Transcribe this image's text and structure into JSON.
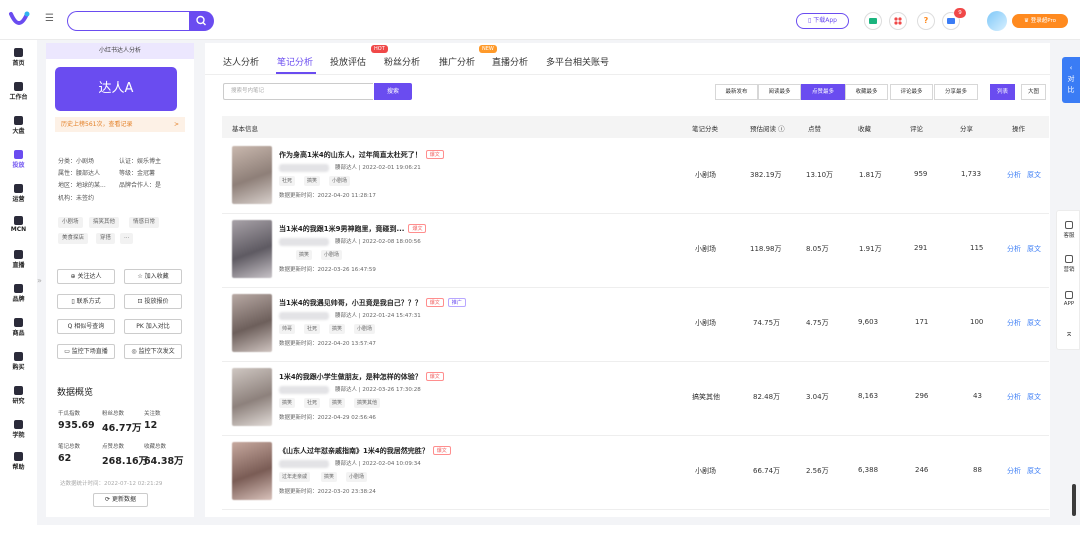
{
  "header": {
    "search_placeholder": "",
    "download_label": "▯ 下载App",
    "notification_count": "9",
    "vip_label": "♛ 登录超Pro"
  },
  "nav": [
    {
      "label": "首页",
      "icon": "home-icon"
    },
    {
      "label": "工作台",
      "icon": "workbench-icon"
    },
    {
      "label": "大盘",
      "icon": "dashboard-icon"
    },
    {
      "label": "投放",
      "icon": "placement-icon"
    },
    {
      "label": "运营",
      "icon": "operations-icon"
    },
    {
      "label": "MCN",
      "icon": "mcn-icon"
    },
    {
      "label": "直播",
      "icon": "live-icon"
    },
    {
      "label": "品牌",
      "icon": "brand-icon"
    },
    {
      "label": "商品",
      "icon": "goods-icon"
    },
    {
      "label": "购买",
      "icon": "cart-icon"
    },
    {
      "label": "研究",
      "icon": "research-icon"
    },
    {
      "label": "学院",
      "icon": "academy-icon"
    },
    {
      "label": "帮助",
      "icon": "help-icon"
    }
  ],
  "profile": {
    "header": "小红书达人分析",
    "name": "达人A",
    "history_text": "历史上榜561次，查看记录",
    "history_arrow": ">",
    "info": {
      "category": "分类：小剧场",
      "certification": "认证：娱乐博主",
      "attribute": "属性：腰部达人",
      "level": "等级：金冠薯",
      "region": "地区：地球的某...",
      "brand_partner": "品牌合作人：是",
      "agency": "机构：未签约"
    },
    "tags": [
      "小剧场",
      "搞笑其他",
      "情感日常",
      "美食探店",
      "穿搭",
      "···"
    ],
    "buttons": {
      "follow": "⊕ 关注达人",
      "favorite": "☆ 加入收藏",
      "contact": "▯ 联系方式",
      "quote": "⊡ 投放报价",
      "similar": "Q 相似号查询",
      "compare": "PK 加入对比",
      "monitor_live": "▭ 监控下场直播",
      "monitor_post": "◎ 监控下次发文"
    },
    "overview": {
      "title": "数据概览",
      "stats": [
        {
          "label": "千瓜指数",
          "value": "935.69"
        },
        {
          "label": "粉丝总数",
          "value": "46.77万"
        },
        {
          "label": "关注数",
          "value": "12"
        },
        {
          "label": "笔记总数",
          "value": "62"
        },
        {
          "label": "点赞总数",
          "value": "268.16万"
        },
        {
          "label": "收藏总数",
          "value": "64.38万"
        }
      ],
      "update_note": "达数据统计时间：2022-07-12 02:21:29",
      "update_button": "⟳ 更新数据"
    }
  },
  "tabs": [
    {
      "label": "达人分析"
    },
    {
      "label": "笔记分析"
    },
    {
      "label": "投放评估"
    },
    {
      "label": "粉丝分析",
      "badge": "HOT"
    },
    {
      "label": "推广分析"
    },
    {
      "label": "直播分析",
      "badge": "NEW"
    },
    {
      "label": "多平台相关账号"
    }
  ],
  "notes_search": {
    "placeholder": "搜索号内笔记",
    "button": "搜索"
  },
  "sort_options": [
    "最新发布",
    "阅读最多",
    "点赞最多",
    "收藏最多",
    "评论最多",
    "分享最多"
  ],
  "view_options": [
    "列表",
    "大图"
  ],
  "table": {
    "columns": [
      "基本信息",
      "笔记分类",
      "预估阅读 ⓘ",
      "点赞",
      "收藏",
      "评论",
      "分享",
      "操作"
    ],
    "actions": [
      "分析",
      "原文"
    ],
    "rows": [
      {
        "title": "作为身高1米4的山东人，过年简直太杜死了！",
        "tag": "爆文",
        "meta": "腰部达人 | 2022-02-01 19:06:21",
        "tags": [
          "社死",
          "搞笑",
          "小剧场"
        ],
        "updated": "数据更新时间：2022-04-20 11:28:17",
        "category": "小剧场",
        "reads": "382.19万",
        "likes": "13.10万",
        "favorites": "1.81万",
        "comments": "959",
        "shares": "1,733"
      },
      {
        "title": "当1米4的我跟1米9男神跑里，竟碰到...",
        "tag": "爆文",
        "meta": "腰部达人 | 2022-02-08 18:00:56",
        "tags": [
          "搞笑",
          "小剧场"
        ],
        "updated": "数据更新时间：2022-03-26 16:47:59",
        "category": "小剧场",
        "reads": "118.98万",
        "likes": "8.05万",
        "favorites": "1.91万",
        "comments": "291",
        "shares": "115"
      },
      {
        "title": "当1米4的我遇见帅哥，小丑竟是我自己？？？",
        "tag": "爆文",
        "tag2": "推广",
        "meta": "腰部达人 | 2022-01-24 15:47:31",
        "tags": [
          "帅哥",
          "社死",
          "搞笑",
          "小剧场"
        ],
        "updated": "数据更新时间：2022-04-20 13:57:47",
        "category": "小剧场",
        "reads": "74.75万",
        "likes": "4.75万",
        "favorites": "9,603",
        "comments": "171",
        "shares": "100"
      },
      {
        "title": "1米4的我跟小学生做朋友，是种怎样的体验？",
        "tag": "爆文",
        "meta": "腰部达人 | 2022-03-26 17:30:28",
        "tags": [
          "搞笑",
          "社死",
          "搞笑",
          "搞笑其他"
        ],
        "updated": "数据更新时间：2022-04-29 02:56:46",
        "category": "搞笑其他",
        "reads": "82.48万",
        "likes": "3.04万",
        "favorites": "8,163",
        "comments": "296",
        "shares": "43"
      },
      {
        "title": "《山东人过年怼亲戚指南》1米4的我居然完胜？",
        "tag": "爆文",
        "meta": "腰部达人 | 2022-02-04 10:09:34",
        "tags": [
          "过年走亲戚",
          "搞笑",
          "小剧场"
        ],
        "updated": "数据更新时间：2022-03-20 23:38:24",
        "category": "小剧场",
        "reads": "66.74万",
        "likes": "2.56万",
        "favorites": "6,388",
        "comments": "246",
        "shares": "88"
      }
    ]
  },
  "side_tools": {
    "compare_label": "对比",
    "items": [
      {
        "label": "客服",
        "icon": "headset-icon"
      },
      {
        "label": "营销",
        "icon": "marketing-icon"
      },
      {
        "label": "APP",
        "icon": "phone-icon"
      },
      {
        "label": "",
        "icon": "back-to-top-icon"
      }
    ]
  },
  "colors": {
    "accent": "#6a4cf0",
    "link": "#3a7cf5",
    "hot": "#f04848",
    "orange": "#ff8a1f"
  }
}
